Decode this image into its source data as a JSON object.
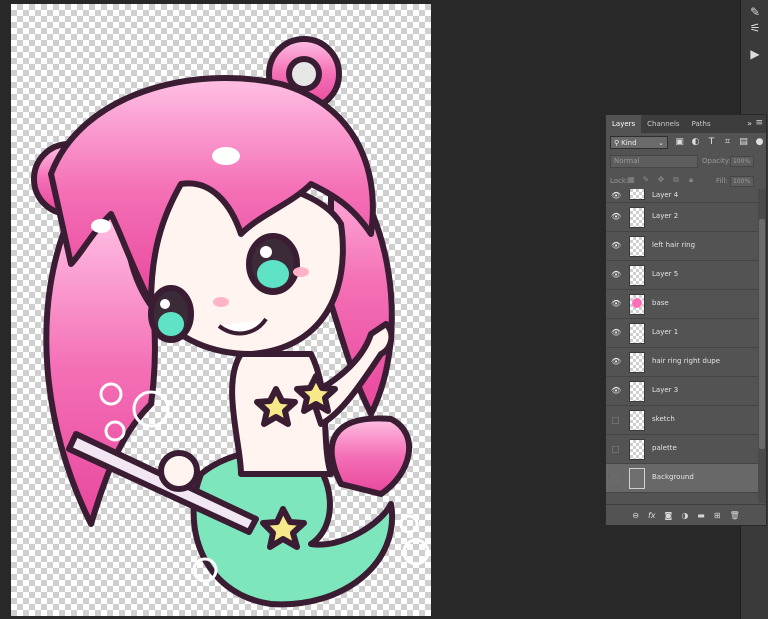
{
  "layers_panel": {
    "tabs": [
      "Layers",
      "Channels",
      "Paths"
    ],
    "collapse_icon": "double-chevron-right",
    "filter_select": "Kind",
    "blend_mode": "Normal",
    "opacity_label": "Opacity:",
    "opacity_value": "100%",
    "lock_label": "Lock:",
    "fill_label": "Fill:",
    "fill_value": "100%",
    "layers": [
      {
        "name": "Layer 4",
        "visible": true
      },
      {
        "name": "Layer 2",
        "visible": true
      },
      {
        "name": "left hair ring",
        "visible": true
      },
      {
        "name": "Layer 5",
        "visible": true
      },
      {
        "name": "base",
        "visible": true
      },
      {
        "name": "Layer 1",
        "visible": true
      },
      {
        "name": "hair ring right dupe",
        "visible": true
      },
      {
        "name": "Layer 3",
        "visible": true
      },
      {
        "name": "sketch",
        "visible": false
      },
      {
        "name": "palette",
        "visible": false
      },
      {
        "name": "Background",
        "visible": false
      }
    ],
    "footer_icons": [
      "link-icon",
      "fx-icon",
      "mask-icon",
      "adjustment-icon",
      "folder-icon",
      "new-layer-icon",
      "trash-icon"
    ]
  },
  "toolbar": {
    "icons": [
      "brush-settings-icon",
      "sliders-icon",
      "play-icon"
    ]
  },
  "colors": {
    "hair_pink": "#f46fb6",
    "tail_mint": "#7ee6bd",
    "star_yellow": "#f7e98a",
    "outline": "#3a1c33",
    "skin": "#fff4ef",
    "panel_bg": "#535353",
    "workspace_bg": "#282828"
  }
}
